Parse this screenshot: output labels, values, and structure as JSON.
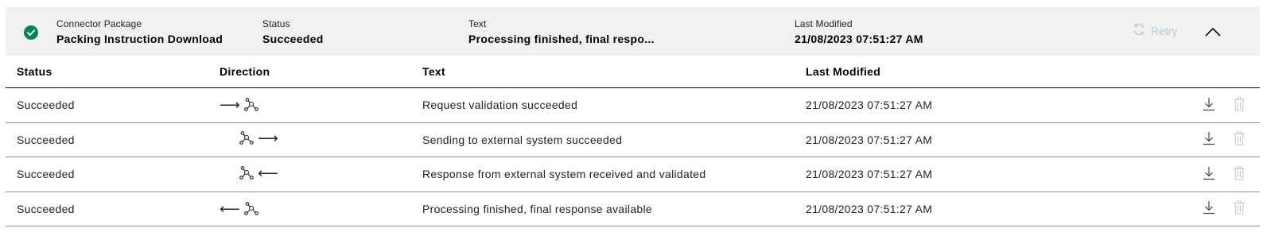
{
  "header": {
    "package_label": "Connector Package",
    "package_value": "Packing Instruction Download",
    "status_label": "Status",
    "status_value": "Succeeded",
    "text_label": "Text",
    "text_value": "Processing finished, final respo...",
    "modified_label": "Last Modified",
    "modified_value": "21/08/2023 07:51:27 AM",
    "retry_label": "Retry",
    "status_color": "#00884a"
  },
  "table": {
    "columns": [
      "Status",
      "Direction",
      "Text",
      "Last Modified"
    ],
    "rows": [
      {
        "status": "Succeeded",
        "direction": "outgoing-to-system",
        "arrow": "⟶",
        "text": "Request validation succeeded",
        "modified": "21/08/2023 07:51:27 AM"
      },
      {
        "status": "Succeeded",
        "direction": "system-to-external",
        "arrow": "⟶",
        "text": "Sending to external system succeeded",
        "modified": "21/08/2023 07:51:27 AM"
      },
      {
        "status": "Succeeded",
        "direction": "external-to-system",
        "arrow": "⟵",
        "text": "Response from external system received and validated",
        "modified": "21/08/2023 07:51:27 AM"
      },
      {
        "status": "Succeeded",
        "direction": "system-to-requester",
        "arrow": "⟵",
        "text": "Processing finished, final response available",
        "modified": "21/08/2023 07:51:27 AM"
      }
    ]
  },
  "icons": {
    "check": "check-icon",
    "retry": "refresh-icon",
    "collapse": "chevron-up-icon",
    "network": "network-icon",
    "download": "download-icon",
    "delete": "trash-icon"
  }
}
